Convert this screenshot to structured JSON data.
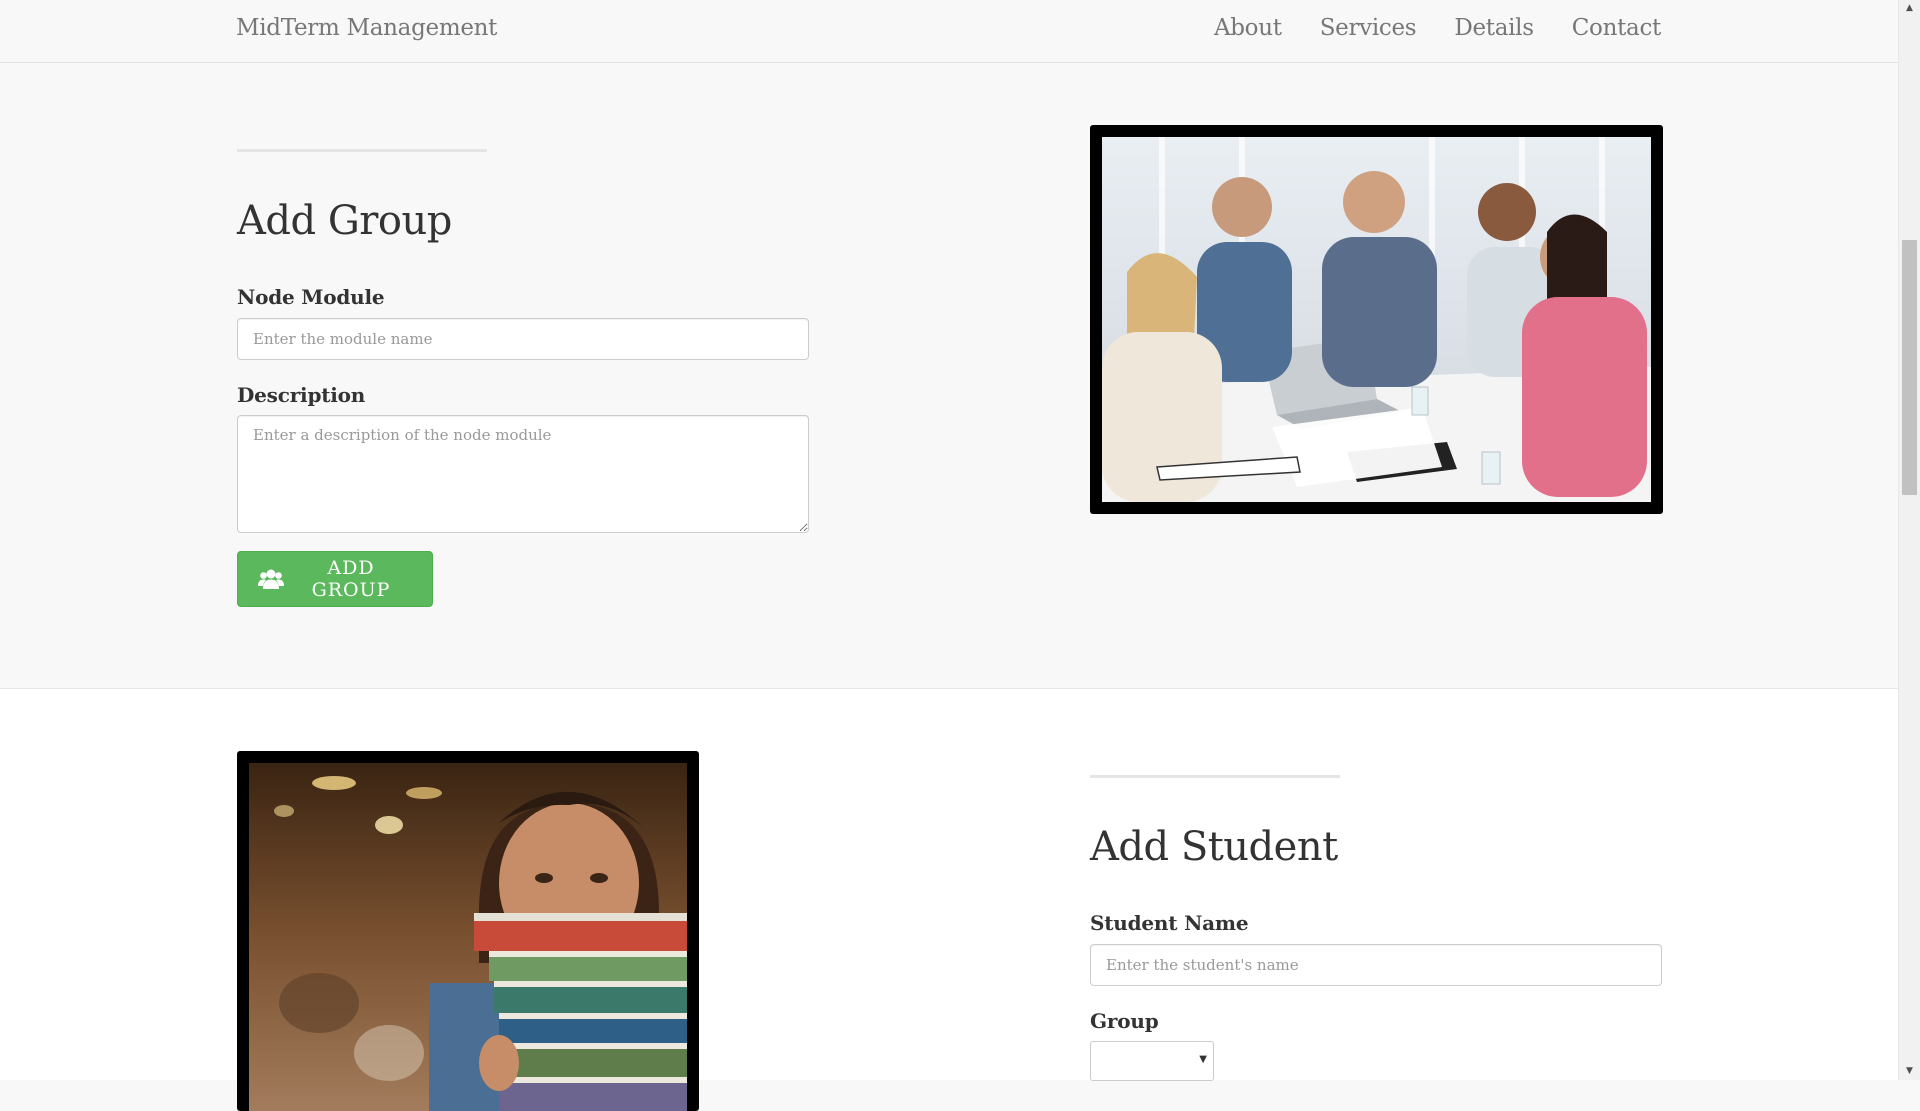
{
  "navbar": {
    "brand": "MidTerm Management",
    "links": [
      "About",
      "Services",
      "Details",
      "Contact"
    ]
  },
  "group_form": {
    "heading": "Add Group",
    "module_label": "Node Module",
    "module_placeholder": "Enter the module name",
    "description_label": "Description",
    "description_placeholder": "Enter a description of the node module",
    "button_label": "Add Group",
    "button_icon": "users-icon"
  },
  "student_form": {
    "heading": "Add Student",
    "name_label": "Student Name",
    "name_placeholder": "Enter the student's name",
    "group_label": "Group",
    "group_selected": ""
  },
  "images": {
    "group_photo": "team-meeting-photo",
    "student_photo": "student-with-books-photo"
  },
  "colors": {
    "accent_green": "#5cb85c",
    "frame": "#000000",
    "nav_text": "#777777"
  }
}
